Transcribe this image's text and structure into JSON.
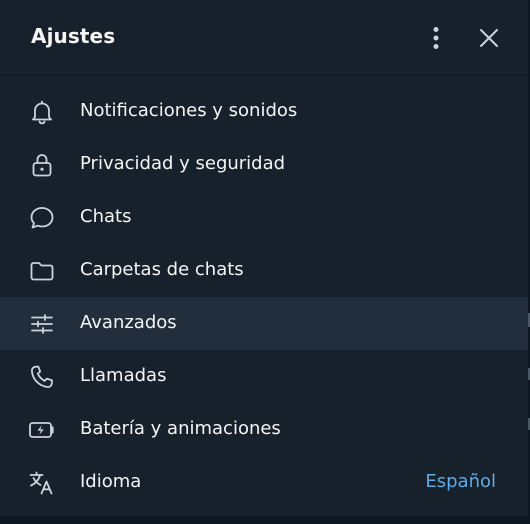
{
  "header": {
    "title": "Ajustes",
    "more_icon": "more-vertical-icon",
    "close_icon": "close-icon"
  },
  "menu": {
    "items": [
      {
        "label": "Notificaciones y sonidos",
        "icon": "bell-icon"
      },
      {
        "label": "Privacidad y seguridad",
        "icon": "lock-icon"
      },
      {
        "label": "Chats",
        "icon": "chat-bubble-icon"
      },
      {
        "label": "Carpetas de chats",
        "icon": "folder-icon"
      },
      {
        "label": "Avanzados",
        "icon": "sliders-icon",
        "active": true
      },
      {
        "label": "Llamadas",
        "icon": "phone-icon"
      },
      {
        "label": "Batería y animaciones",
        "icon": "battery-icon"
      },
      {
        "label": "Idioma",
        "icon": "translate-icon",
        "value": "Español"
      }
    ]
  },
  "colors": {
    "background": "#17212b",
    "active_row": "#232e3c",
    "text": "#f5f5f5",
    "icon": "#ccd3da",
    "accent": "#5eabe9"
  }
}
